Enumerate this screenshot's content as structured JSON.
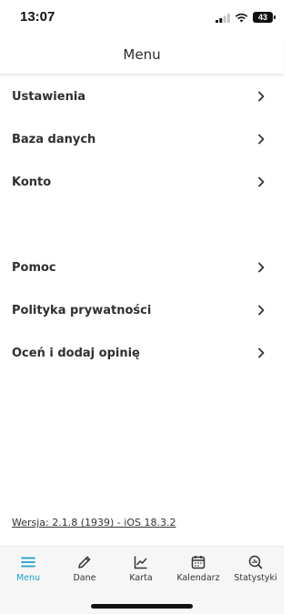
{
  "status_bar": {
    "time": "13:07",
    "battery": "43"
  },
  "header": {
    "title": "Menu"
  },
  "menu": {
    "items": [
      {
        "label": "Ustawienia"
      },
      {
        "label": "Baza danych"
      },
      {
        "label": "Konto"
      },
      {
        "label": "Pomoc"
      },
      {
        "label": "Polityka prywatności"
      },
      {
        "label": "Oceń i dodaj opinię"
      }
    ]
  },
  "footer": {
    "version": "Wersja: 2.1.8 (1939) - iOS 18.3.2"
  },
  "tab_bar": {
    "active_color": "#1aa0c8",
    "tabs": [
      {
        "label": "Menu",
        "icon": "list-icon"
      },
      {
        "label": "Dane",
        "icon": "pencil-icon"
      },
      {
        "label": "Karta",
        "icon": "chart-line-icon"
      },
      {
        "label": "Kalendarz",
        "icon": "calendar-icon"
      },
      {
        "label": "Statystyki",
        "icon": "stats-icon"
      }
    ]
  }
}
